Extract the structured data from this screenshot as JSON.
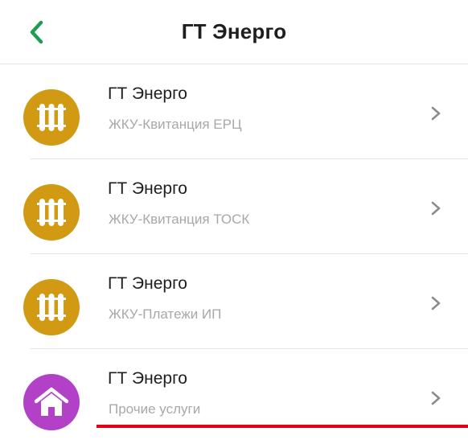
{
  "header": {
    "title": "ГТ Энерго",
    "back_icon": "chevron-left-icon",
    "back_color": "#1f9d55"
  },
  "items": [
    {
      "title": "ГТ Энерго",
      "subtitle": "ЖКУ-Квитанция ЕРЦ",
      "icon": "radiator-icon",
      "icon_color": "#d29a12"
    },
    {
      "title": "ГТ Энерго",
      "subtitle": "ЖКУ-Квитанция ТОСК",
      "icon": "radiator-icon",
      "icon_color": "#d29a12"
    },
    {
      "title": "ГТ Энерго",
      "subtitle": "ЖКУ-Платежи ИП",
      "icon": "radiator-icon",
      "icon_color": "#d29a12"
    },
    {
      "title": "ГТ Энерго",
      "subtitle": "Прочие услуги",
      "icon": "house-icon",
      "icon_color": "#b241c8"
    }
  ],
  "accent_underline_color": "#e4001b"
}
